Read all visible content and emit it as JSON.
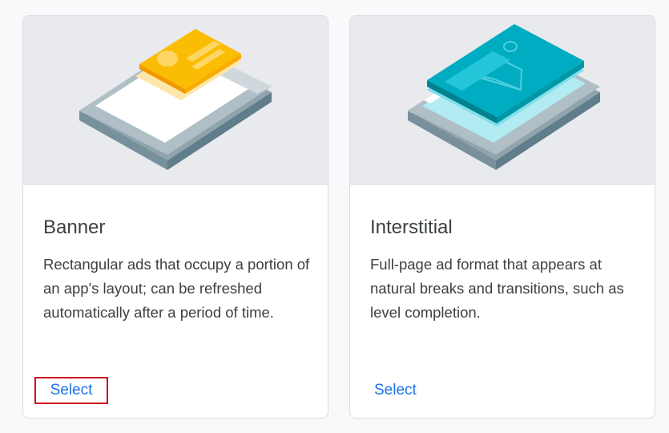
{
  "cards": [
    {
      "title": "Banner",
      "description": "Rectangular ads that occupy a portion of an app's layout; can be refreshed automatically after a period of time.",
      "button_label": "Select",
      "icon": "banner-ad-illustration"
    },
    {
      "title": "Interstitial",
      "description": "Full-page ad format that appears at natural breaks and transitions, such as level completion.",
      "button_label": "Select",
      "icon": "interstitial-ad-illustration"
    }
  ],
  "colors": {
    "accent": "#1a73e8",
    "highlight_border": "#d0021b",
    "banner_yellow": "#fbbc04",
    "interstitial_teal": "#00acc1"
  }
}
